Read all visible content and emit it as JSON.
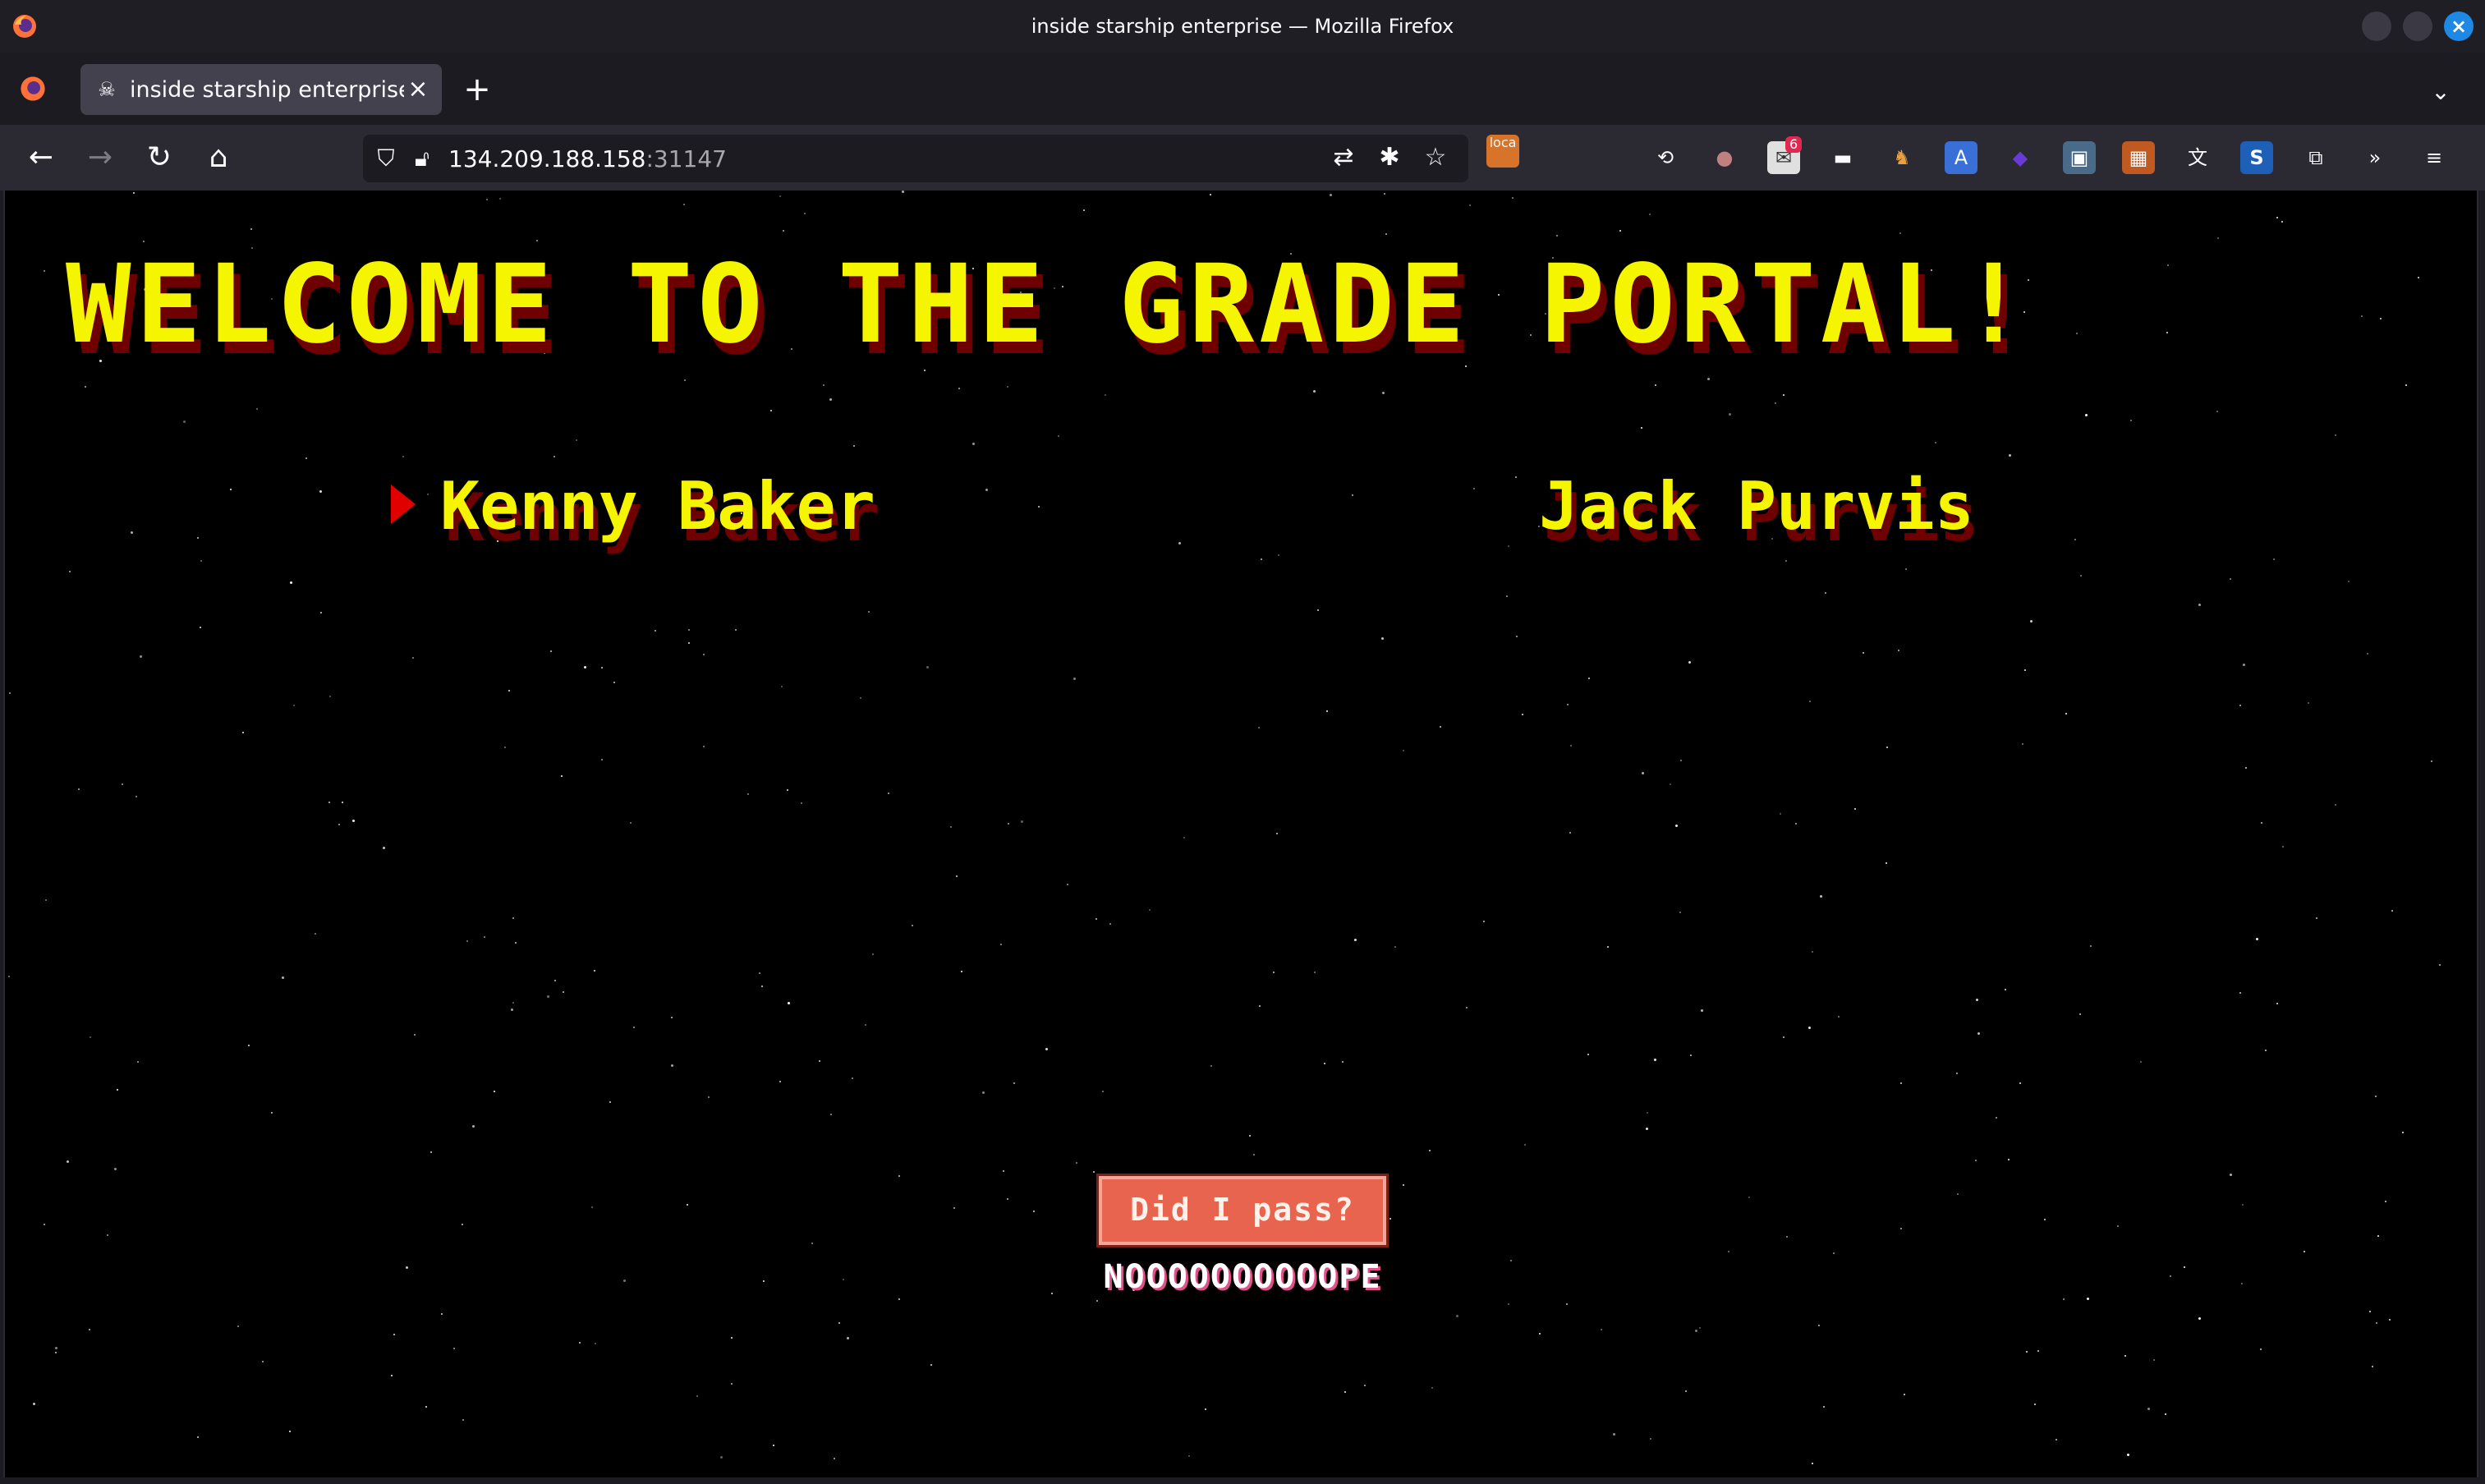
{
  "window": {
    "title": "inside starship enterprise — Mozilla Firefox"
  },
  "tabs": [
    {
      "title": "inside starship enterprise",
      "icon": "stormtrooper-icon",
      "active": true
    }
  ],
  "url": {
    "host": "134.209.188.158",
    "port": ":31147"
  },
  "extensions": {
    "mail_badge": "6",
    "loca_label": "loca"
  },
  "page": {
    "headline": "WELCOME TO THE GRADE PORTAL!",
    "students": [
      "Kenny Baker",
      "Jack Purvis"
    ],
    "selected_student_index": 0,
    "check_button": "Did I pass?",
    "result": "NOOOOOOOOOOPE"
  },
  "colors": {
    "page_background": "#000000",
    "title_yellow": "#f5f500",
    "shadow_red": "#6e0000",
    "button_red": "#e8644e",
    "selector_red": "#e00000"
  }
}
